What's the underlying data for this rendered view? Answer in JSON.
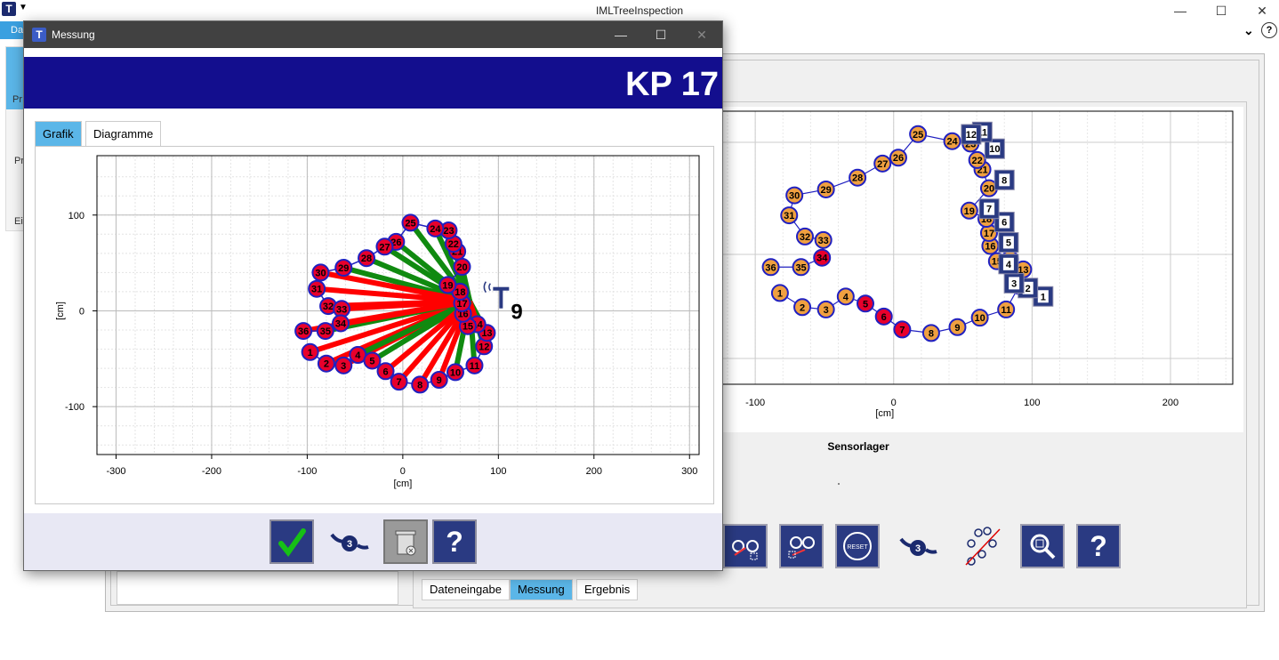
{
  "main_window": {
    "title": "IMLTreeInspection",
    "ribbon_tab": "Da",
    "left_labels": [
      "Pr",
      "Pr",
      "Ei"
    ],
    "sensorlager_label": "Sensorlager",
    "bottom_tabs": [
      {
        "label": "Dateneingabe",
        "active": false
      },
      {
        "label": "Messung",
        "active": true
      },
      {
        "label": "Ergebnis",
        "active": false
      }
    ],
    "toolbar_icons": [
      "sensor-select-icon",
      "sensor-move-icon",
      "reset-icon",
      "tree-3-icon",
      "network-disable-icon",
      "zoom-icon",
      "help-icon"
    ],
    "reset_label": "RESET"
  },
  "dialog": {
    "title": "Messung",
    "kp_label": "KP 17",
    "tabs": [
      {
        "label": "Grafik",
        "active": true
      },
      {
        "label": "Diagramme",
        "active": false
      }
    ],
    "sensor_number": "9",
    "help_label": "?",
    "tree_badge": "3"
  },
  "colors": {
    "banner": "#130e8e",
    "point_red": "#e8002c",
    "point_orange": "#f0a040",
    "ray_red": "#ff0000",
    "ray_green": "#108a10",
    "point_stroke": "#2020c0",
    "sensor_box": "#2a3a82",
    "accent_tab": "#5bb6e8"
  },
  "chart_data": [
    {
      "type": "scatter",
      "name": "dialog-grafik",
      "xlabel": "[cm]",
      "ylabel": "[cm]",
      "xlim": [
        -320,
        310
      ],
      "ylim": [
        -150,
        162
      ],
      "xticks": [
        -300,
        -200,
        -100,
        0,
        100,
        200,
        300
      ],
      "yticks": [
        -100,
        0,
        100
      ],
      "grid": true,
      "center": [
        70,
        10
      ],
      "sensor_position": [
        100,
        10
      ],
      "points": [
        {
          "label": "1",
          "x": -97,
          "y": -43
        },
        {
          "label": "2",
          "x": -80,
          "y": -55
        },
        {
          "label": "3",
          "x": -62,
          "y": -57
        },
        {
          "label": "4",
          "x": -47,
          "y": -46
        },
        {
          "label": "5",
          "x": -32,
          "y": -52
        },
        {
          "label": "6",
          "x": -18,
          "y": -63
        },
        {
          "label": "7",
          "x": -4,
          "y": -74
        },
        {
          "label": "8",
          "x": 18,
          "y": -77
        },
        {
          "label": "9",
          "x": 38,
          "y": -72
        },
        {
          "label": "10",
          "x": 55,
          "y": -64
        },
        {
          "label": "11",
          "x": 75,
          "y": -57
        },
        {
          "label": "12",
          "x": 85,
          "y": -37
        },
        {
          "label": "13",
          "x": 88,
          "y": -23
        },
        {
          "label": "14",
          "x": 78,
          "y": -14
        },
        {
          "label": "15",
          "x": 68,
          "y": -16
        },
        {
          "label": "16",
          "x": 63,
          "y": -3
        },
        {
          "label": "17",
          "x": 62,
          "y": 8
        },
        {
          "label": "18",
          "x": 60,
          "y": 20
        },
        {
          "label": "19",
          "x": 47,
          "y": 27
        },
        {
          "label": "20",
          "x": 62,
          "y": 46
        },
        {
          "label": "21",
          "x": 57,
          "y": 62
        },
        {
          "label": "22",
          "x": 53,
          "y": 70
        },
        {
          "label": "23",
          "x": 48,
          "y": 84
        },
        {
          "label": "24",
          "x": 34,
          "y": 86
        },
        {
          "label": "25",
          "x": 8,
          "y": 92
        },
        {
          "label": "26",
          "x": -7,
          "y": 72
        },
        {
          "label": "27",
          "x": -19,
          "y": 67
        },
        {
          "label": "28",
          "x": -38,
          "y": 55
        },
        {
          "label": "29",
          "x": -62,
          "y": 45
        },
        {
          "label": "30",
          "x": -86,
          "y": 40
        },
        {
          "label": "31",
          "x": -90,
          "y": 23
        },
        {
          "label": "32",
          "x": -78,
          "y": 5
        },
        {
          "label": "33",
          "x": -64,
          "y": 2
        },
        {
          "label": "34",
          "x": -65,
          "y": -13
        },
        {
          "label": "35",
          "x": -81,
          "y": -21
        },
        {
          "label": "36",
          "x": -104,
          "y": -21
        }
      ],
      "green_points": [
        "4",
        "5",
        "10",
        "11",
        "12",
        "13",
        "16",
        "17",
        "19",
        "20",
        "21",
        "22",
        "23",
        "24",
        "25",
        "26",
        "27",
        "28",
        "29",
        "35"
      ]
    },
    {
      "type": "scatter",
      "name": "background-overview",
      "xlabel": "[cm]",
      "xlim": [
        -138,
        245
      ],
      "xticks": [
        -100,
        0,
        100,
        200,
        300
      ],
      "grid": true,
      "red_points": [
        "5",
        "6",
        "7",
        "34"
      ],
      "sensors": [
        {
          "label": "1",
          "x": 108,
          "y": -35
        },
        {
          "label": "2",
          "x": 97,
          "y": -28
        },
        {
          "label": "3",
          "x": 87,
          "y": -24
        },
        {
          "label": "4",
          "x": 83,
          "y": -8
        },
        {
          "label": "5",
          "x": 83,
          "y": 10
        },
        {
          "label": "6",
          "x": 80,
          "y": 27
        },
        {
          "label": "7",
          "x": 69,
          "y": 38
        },
        {
          "label": "8",
          "x": 80,
          "y": 62
        },
        {
          "label": "10",
          "x": 73,
          "y": 88
        },
        {
          "label": "11",
          "x": 64,
          "y": 102
        },
        {
          "label": "12",
          "x": 56,
          "y": 100
        }
      ]
    }
  ]
}
